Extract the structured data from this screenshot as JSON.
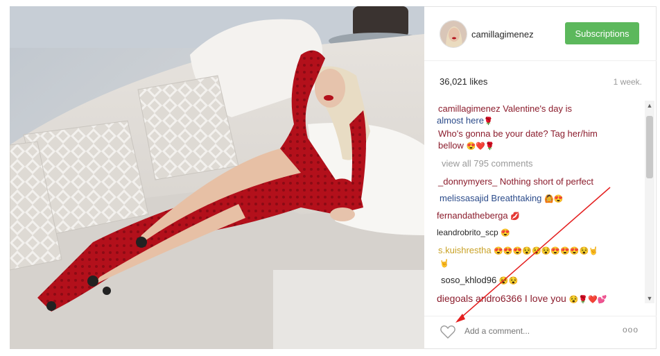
{
  "post": {
    "username": "camillagimenez",
    "subscribe_label": "Subscriptions",
    "likes": "36,021 likes",
    "time": "1 week."
  },
  "caption": {
    "username": "camillagimenez",
    "line1_text": " Valentine's day is",
    "line2_text": "almost here",
    "line2_emoji": "🌹",
    "line3": "Who's gonna be your date? Tag her/him",
    "line4_text": "bellow ",
    "line4_emoji": "😍❤️🌹"
  },
  "view_all": "view all 795 comments",
  "comments": [
    {
      "user": "_donnymyers_",
      "text": " Nothing short of perfect"
    },
    {
      "user": "melissasajid",
      "text": " Breathtaking ",
      "emoji": "🙆😍"
    },
    {
      "user": "fernandatheberga",
      "text": " ",
      "emoji": "💋"
    },
    {
      "user": "leandrobrito_scp",
      "text": " ",
      "emoji": "😍"
    },
    {
      "user": "s.kuishrestha",
      "text": " ",
      "emoji": "😍😍😍😵😵😵😍😍😍😵🤘",
      "emoji2": "🤘"
    },
    {
      "user": "soso_khlod96",
      "text": " ",
      "emoji": "😵😵"
    },
    {
      "user": "diegoals andro6366",
      "text": " I love you ",
      "emoji": "😵🌹❤️💕"
    }
  ],
  "footer": {
    "placeholder": "Add a comment...",
    "more": "ooo"
  },
  "icons": {
    "heart": "heart-icon",
    "options": "more-options-icon",
    "avatar": "avatar"
  },
  "colors": {
    "subscribe": "#5cb85c",
    "annotation_arrow": "#e41f1f",
    "dress": "#b3101b"
  }
}
